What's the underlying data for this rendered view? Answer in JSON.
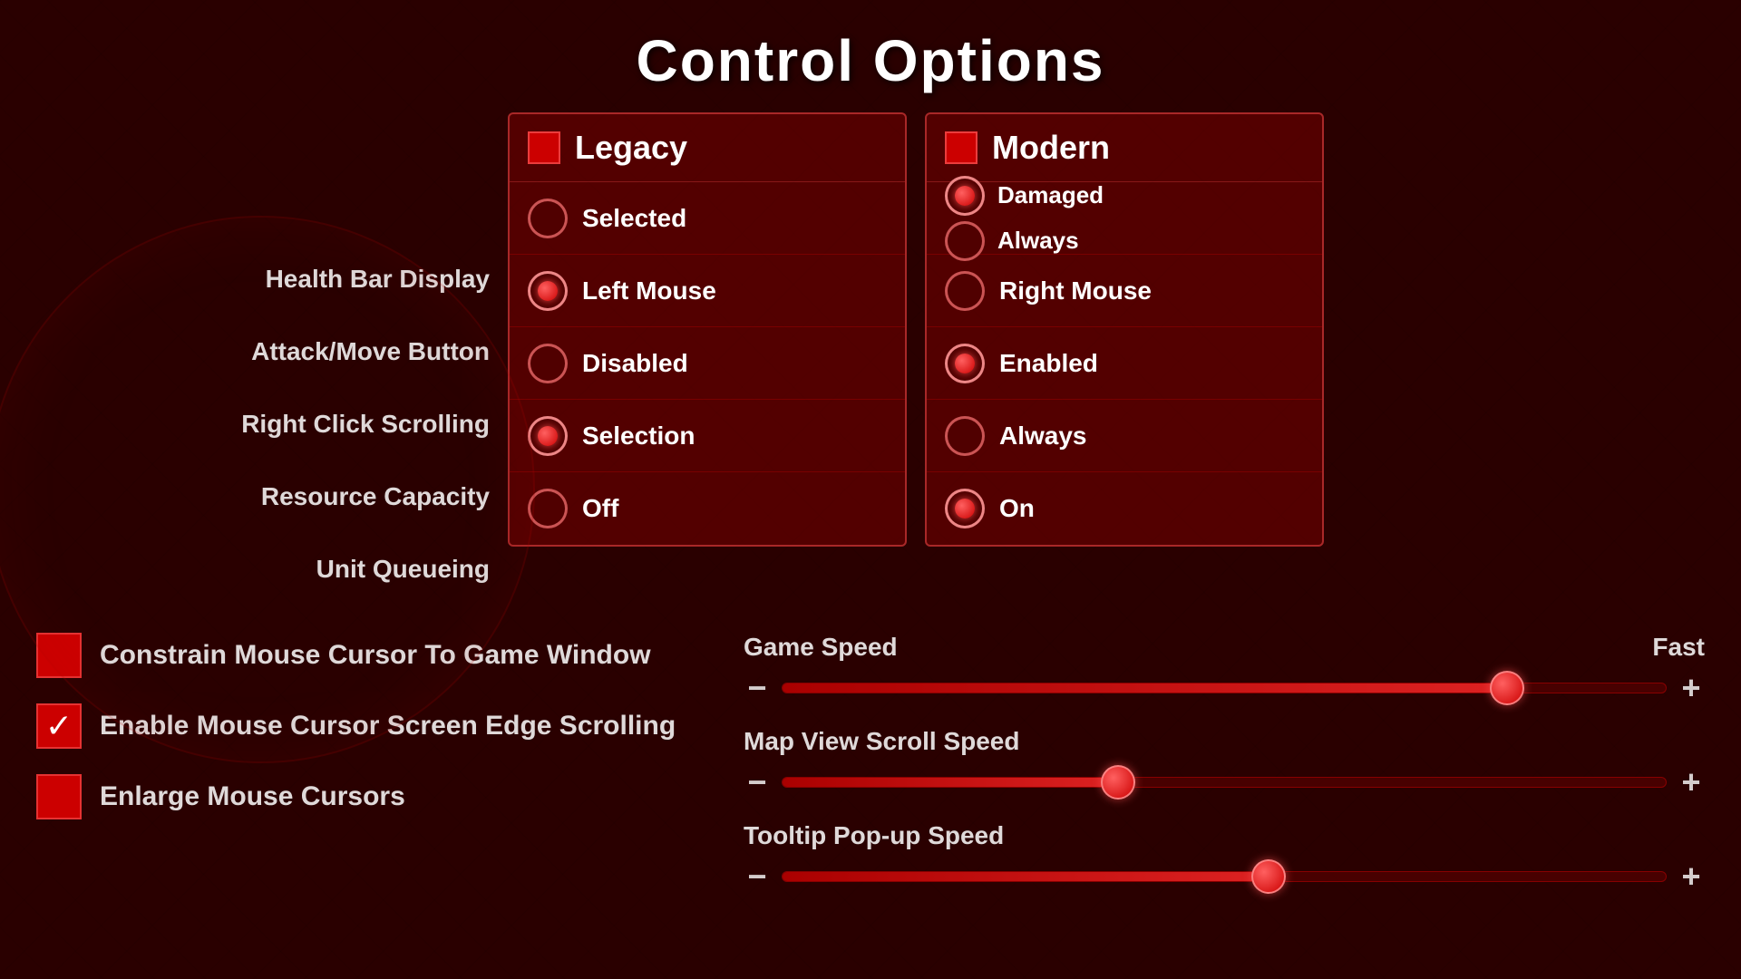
{
  "title": "Control Options",
  "panels": {
    "legacy": {
      "header": "Legacy",
      "rows": [
        {
          "label": "Selected",
          "selected": false
        },
        {
          "label": "Left Mouse",
          "selected": true
        },
        {
          "label": "Disabled",
          "selected": false
        },
        {
          "label": "Selection",
          "selected": true
        },
        {
          "label": "Off",
          "selected": false
        }
      ]
    },
    "modern": {
      "header": "Modern",
      "healthRows": [
        {
          "label": "Damaged",
          "selected": true
        },
        {
          "label": "Always",
          "selected": false
        }
      ],
      "rows": [
        {
          "label": "Right Mouse",
          "selected": false
        },
        {
          "label": "Enabled",
          "selected": true
        },
        {
          "label": "Always",
          "selected": false
        },
        {
          "label": "On",
          "selected": true
        }
      ]
    }
  },
  "rowLabels": [
    "Health Bar Display",
    "Attack/Move Button",
    "Right Click Scrolling",
    "Resource Capacity",
    "Unit Queueing"
  ],
  "checkboxes": [
    {
      "label": "Constrain Mouse Cursor To Game Window",
      "checked": false
    },
    {
      "label": "Enable Mouse Cursor Screen Edge Scrolling",
      "checked": true
    },
    {
      "label": "Enlarge Mouse Cursors",
      "checked": false
    }
  ],
  "sliders": [
    {
      "label": "Game Speed",
      "value_label": "Fast",
      "fill_pct": 82,
      "thumb_pct": 82
    },
    {
      "label": "Map View Scroll Speed",
      "value_label": "",
      "fill_pct": 38,
      "thumb_pct": 38
    },
    {
      "label": "Tooltip Pop-up Speed",
      "value_label": "",
      "fill_pct": 55,
      "thumb_pct": 55
    }
  ],
  "icons": {
    "minus": "−",
    "plus": "+"
  }
}
